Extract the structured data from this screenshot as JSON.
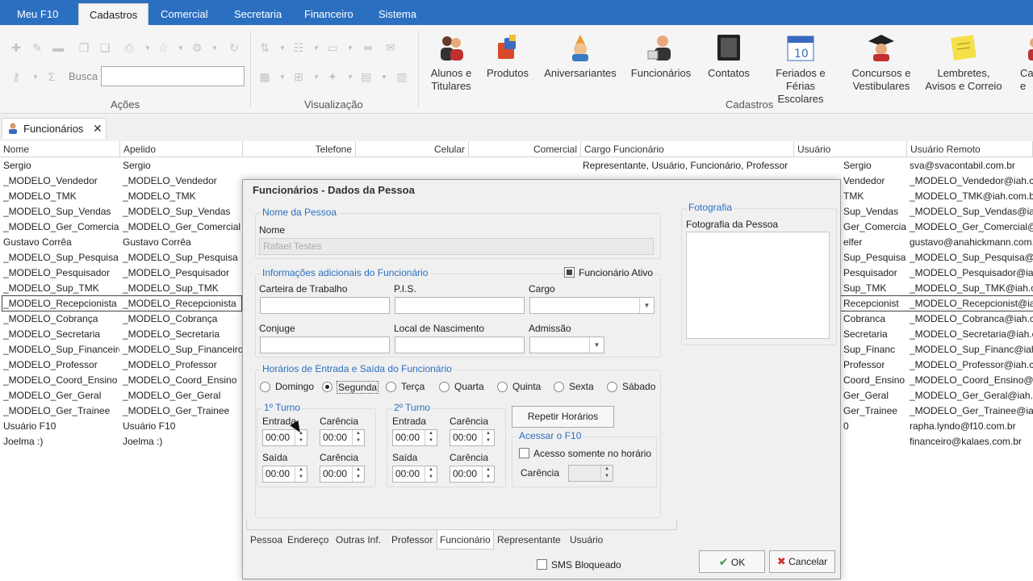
{
  "menu": {
    "tabs": [
      "Meu F10",
      "Cadastros",
      "Comercial",
      "Secretaria",
      "Financeiro",
      "Sistema"
    ],
    "active": "Cadastros"
  },
  "ribbon": {
    "busca_label": "Busca",
    "busca_value": "",
    "groups": {
      "acoes": "Ações",
      "visualizacao": "Visualização",
      "cadastros": "Cadastros"
    },
    "buttons": {
      "alunos": [
        "Alunos e",
        "Titulares"
      ],
      "produtos": "Produtos",
      "aniversariantes": "Aniversariantes",
      "funcionarios": "Funcionários",
      "contatos": "Contatos",
      "feriados": [
        "Feriados e",
        "Férias Escolares"
      ],
      "concursos": [
        "Concursos e",
        "Vestibulares"
      ],
      "lembretes": [
        "Lembretes,",
        "Avisos e Correio"
      ],
      "cut": [
        "Ca",
        "e"
      ]
    }
  },
  "doctab": {
    "label": "Funcionários",
    "close": "✕"
  },
  "grid": {
    "headers": {
      "nome": "Nome",
      "apelido": "Apelido",
      "telefone": "Telefone",
      "celular": "Celular",
      "comercial": "Comercial",
      "cargo": "Cargo Funcionário",
      "usuario": "Usuário",
      "remoto": "Usuário Remoto"
    },
    "rows": [
      {
        "nome": "Sergio",
        "apelido": "Sergio",
        "usuario": "Sergio",
        "remoto": "sva@svacontabil.com.br",
        "cargo": "Representante, Usuário, Funcionário, Professor"
      },
      {
        "nome": "_MODELO_Vendedor",
        "apelido": "_MODELO_Vendedor",
        "usuario": "Vendedor",
        "remoto": "_MODELO_Vendedor@iah.co"
      },
      {
        "nome": "_MODELO_TMK",
        "apelido": "_MODELO_TMK",
        "usuario": "TMK",
        "remoto": "_MODELO_TMK@iah.com.br"
      },
      {
        "nome": "_MODELO_Sup_Vendas",
        "apelido": "_MODELO_Sup_Vendas",
        "usuario": "Sup_Vendas",
        "remoto": "_MODELO_Sup_Vendas@iah"
      },
      {
        "nome": "_MODELO_Ger_Comercial",
        "apelido": "_MODELO_Ger_Comercial",
        "usuario": "Ger_Comercia",
        "remoto": "_MODELO_Ger_Comercial@iah"
      },
      {
        "nome": "Gustavo Corrêa",
        "apelido": "Gustavo Corrêa",
        "usuario": "elfer",
        "remoto": "gustavo@anahickmann.com."
      },
      {
        "nome": "_MODELO_Sup_Pesquisa",
        "apelido": "_MODELO_Sup_Pesquisa",
        "usuario": "Sup_Pesquisa",
        "remoto": "_MODELO_Sup_Pesquisa@iah"
      },
      {
        "nome": "_MODELO_Pesquisador",
        "apelido": "_MODELO_Pesquisador",
        "usuario": "Pesquisador",
        "remoto": "_MODELO_Pesquisador@iah.c"
      },
      {
        "nome": "_MODELO_Sup_TMK",
        "apelido": "_MODELO_Sup_TMK",
        "usuario": "Sup_TMK",
        "remoto": "_MODELO_Sup_TMK@iah.com"
      },
      {
        "nome": "_MODELO_Recepcionista",
        "apelido": "_MODELO_Recepcionista",
        "usuario": "Recepcionist",
        "remoto": "_MODELO_Recepcionist@iah"
      },
      {
        "nome": "_MODELO_Cobrança",
        "apelido": "_MODELO_Cobrança",
        "usuario": "Cobranca",
        "remoto": "_MODELO_Cobranca@iah.co"
      },
      {
        "nome": "_MODELO_Secretaria",
        "apelido": "_MODELO_Secretaria",
        "usuario": "Secretaria",
        "remoto": "_MODELO_Secretaria@iah.co"
      },
      {
        "nome": "_MODELO_Sup_Financeiro",
        "apelido": "_MODELO_Sup_Financeiro",
        "usuario": "Sup_Financ",
        "remoto": "_MODELO_Sup_Financ@iah."
      },
      {
        "nome": "_MODELO_Professor",
        "apelido": "_MODELO_Professor",
        "usuario": "Professor",
        "remoto": "_MODELO_Professor@iah.co"
      },
      {
        "nome": "_MODELO_Coord_Ensino",
        "apelido": "_MODELO_Coord_Ensino",
        "usuario": "Coord_Ensino",
        "remoto": "_MODELO_Coord_Ensino@ia"
      },
      {
        "nome": "_MODELO_Ger_Geral",
        "apelido": "_MODELO_Ger_Geral",
        "usuario": "Ger_Geral",
        "remoto": "_MODELO_Ger_Geral@iah.co"
      },
      {
        "nome": "_MODELO_Ger_Trainee",
        "apelido": "_MODELO_Ger_Trainee",
        "usuario": "Ger_Trainee",
        "remoto": "_MODELO_Ger_Trainee@iah"
      },
      {
        "nome": "Usuário F10",
        "apelido": "Usuário F10",
        "usuario": "0",
        "remoto": "rapha.lyndo@f10.com.br"
      },
      {
        "nome": "Joelma :)",
        "apelido": "Joelma :)",
        "usuario": "",
        "remoto": "financeiro@kalaes.com.br"
      }
    ]
  },
  "dialog": {
    "title": "Funcionários - Dados da Pessoa",
    "nome_group": "Nome da Pessoa",
    "nome_label": "Nome",
    "nome_value": "Rafael Testes",
    "info_group": "Informações adicionais do Funcionário",
    "ativo_label": "Funcionário Ativo",
    "carteira_label": "Carteira de Trabalho",
    "pis_label": "P.I.S.",
    "cargo_label": "Cargo",
    "conjuge_label": "Conjuge",
    "local_label": "Local de Nascimento",
    "admissao_label": "Admissão",
    "horarios_group": "Horários de Entrada e Saída do Funcionário",
    "days": [
      "Domingo",
      "Segunda",
      "Terça",
      "Quarta",
      "Quinta",
      "Sexta",
      "Sábado"
    ],
    "turno1": "1º Turno",
    "turno2": "2º Turno",
    "entrada": "Entrada",
    "saida": "Saída",
    "carencia": "Carência",
    "time": "00:00",
    "repetir": "Repetir Horários",
    "acessar_group": "Acessar o F10",
    "acesso_label": "Acesso somente no horário",
    "foto_group": "Fotografia",
    "foto_label": "Fotografia da Pessoa",
    "tabs": [
      "Pessoa",
      "Endereço",
      "Outras Inf.",
      "Professor",
      "Funcionário",
      "Representante",
      "Usuário"
    ],
    "sms_label": "SMS Bloqueado",
    "ok": "OK",
    "cancel": "Cancelar"
  },
  "colors": {
    "accent": "#2b6fc1",
    "ok_check": "#3a9a3a",
    "cancel_x": "#d03030"
  }
}
